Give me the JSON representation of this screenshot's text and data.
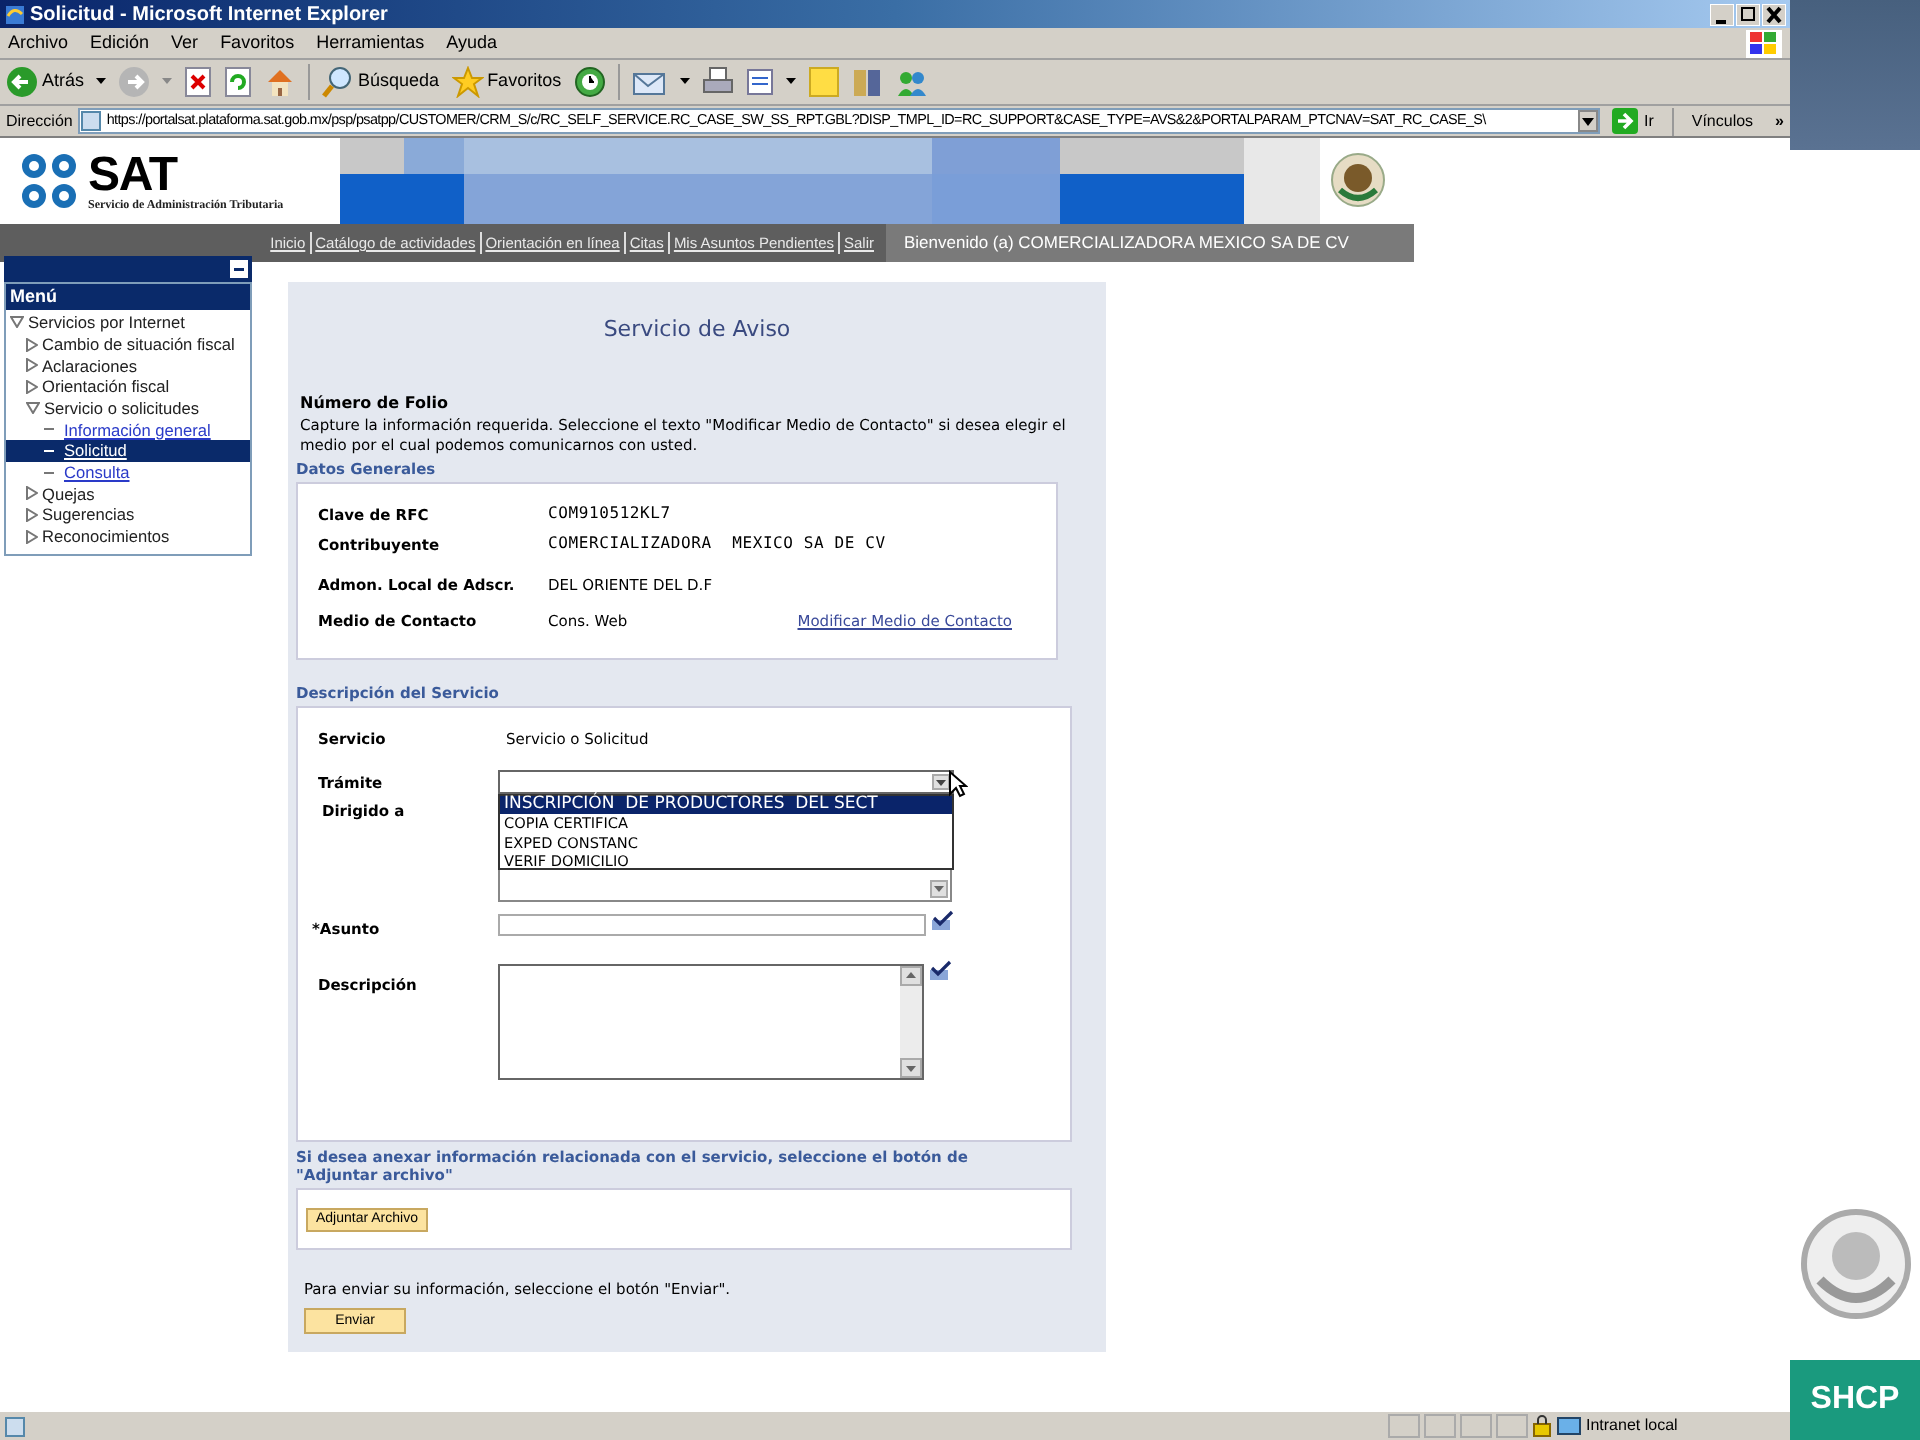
{
  "window": {
    "title": "Solicitud - Microsoft Internet Explorer"
  },
  "menu": [
    "Archivo",
    "Edición",
    "Ver",
    "Favoritos",
    "Herramientas",
    "Ayuda"
  ],
  "toolbar": {
    "back": "Atrás",
    "search": "Búsqueda",
    "favorites": "Favoritos"
  },
  "address": {
    "label": "Dirección",
    "url": "https://portalsat.plataforma.sat.gob.mx/psp/psatpp/CUSTOMER/CRM_S/c/RC_SELF_SERVICE.RC_CASE_SW_SS_RPT.GBL?DISP_TMPL_ID=RC_SUPPORT&CASE_TYPE=AVS&2&PORTALPARAM_PTCNAV=SAT_RC_CASE_S\\",
    "go": "Ir",
    "links": "Vínculos",
    "more": "»"
  },
  "site": {
    "logo": "SAT",
    "logo_subtitle": "Servicio de Administración Tributaria",
    "nav": [
      "Inicio",
      "Catálogo de actividades",
      "Orientación en línea",
      "Citas",
      "Mis Asuntos Pendientes",
      "Salir"
    ],
    "welcome": "Bienvenido (a)  COMERCIALIZADORA MEXICO SA DE CV"
  },
  "sidebar": {
    "title": "Menú",
    "items": [
      {
        "label": "Servicios por Internet",
        "kind": "branch",
        "expanded": true,
        "selected": false,
        "children": [
          {
            "label": "Cambio de situación fiscal",
            "kind": "branch",
            "expanded": false,
            "selected": false
          },
          {
            "label": "Aclaraciones",
            "kind": "branch",
            "expanded": false,
            "selected": false
          },
          {
            "label": "Orientación fiscal",
            "kind": "branch",
            "expanded": false,
            "selected": false
          },
          {
            "label": "Servicio o solicitudes",
            "kind": "branch",
            "expanded": true,
            "selected": false,
            "children": [
              {
                "label": "Información general",
                "kind": "link",
                "selected": false
              },
              {
                "label": "Solicitud",
                "kind": "link",
                "selected": true
              },
              {
                "label": "Consulta",
                "kind": "link",
                "selected": false
              }
            ]
          },
          {
            "label": "Quejas",
            "kind": "branch",
            "expanded": false,
            "selected": false
          },
          {
            "label": "Sugerencias",
            "kind": "branch",
            "expanded": false,
            "selected": false
          },
          {
            "label": "Reconocimientos",
            "kind": "branch",
            "expanded": false,
            "selected": false
          }
        ]
      }
    ]
  },
  "form": {
    "title": "Servicio de Aviso",
    "folio_label": "Número de Folio",
    "instructions": "Capture la información requerida. Seleccione el texto \"Modificar Medio de Contacto\" si desea elegir el medio por el cual podemos comunicarnos con usted.",
    "general": {
      "heading": "Datos Generales",
      "rows": [
        {
          "label": "Clave de RFC",
          "value": "COM910512KL7"
        },
        {
          "label": "Contribuyente",
          "value": "COMERCIALIZADORA  MEXICO SA DE CV"
        },
        {
          "label": "Admon. Local de Adscr.",
          "value": "DEL ORIENTE DEL D.F"
        },
        {
          "label": "Medio de Contacto",
          "value": "Cons. Web"
        }
      ],
      "modify_link": "Modificar Medio de Contacto"
    },
    "service": {
      "heading": "Descripción del Servicio",
      "servicio_label": "Servicio",
      "servicio_value": "Servicio o Solicitud",
      "tramite_label": "Trámite",
      "tramite_options": [
        {
          "label": "INSCRIPCIÓN  DE PRODUCTORES  DEL SECT",
          "selected": true
        },
        {
          "label": "COPIA CERTIFICA",
          "selected": false
        },
        {
          "label": "EXPED CONSTANC",
          "selected": false
        },
        {
          "label": "VERIF DOMICILIO",
          "selected": false
        }
      ],
      "dirigido_label": "Dirigido a",
      "asunto_label": "*Asunto",
      "descripcion_label": "Descripción"
    },
    "attach_text": "Si desea anexar información relacionada con el servicio, seleccione el botón de \"Adjuntar archivo\"",
    "attach_button": "Adjuntar Archivo",
    "send_text": "Para enviar su información, seleccione el botón \"Enviar\".",
    "send_button": "Enviar"
  },
  "status_bar": {
    "zone": "Intranet local"
  },
  "side_brand": "SHCP"
}
